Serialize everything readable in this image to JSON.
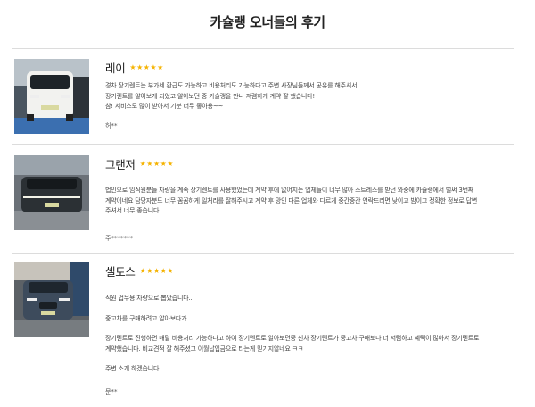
{
  "title": "카슐랭 오너들의 후기",
  "reviews": [
    {
      "car": "레이",
      "stars": "★★★★★",
      "lines": [
        "경차 장기렌트는 부가세 환급도 가능하고 비용처리도 가능하다고 주변 사장님들께서 공유를 해주셔서",
        "장기렌트를 알아보게 되었고 알아보던 중 카슐랭을 만나 저렴하게 계약 잘 했습니다!",
        "참! 서비스도 많이 받아서 기분 너무 좋아용~~"
      ],
      "author": "허**"
    },
    {
      "car": "그랜저",
      "stars": "★★★★★",
      "lines": [
        "법인으로 임직원분들 차량을 계속 장기렌트를 사용했었는데 계약 후에 없어지는 업체들이 너무 많아 스트레스를 받던 와중에 카슐랭에서 벌써 3번째",
        "계약이네요 담당자분도 너무 꼼꼼하게 일처리를 잘해주시고 계약 후 망인 다른 업체와 다르게 중간중간 연락드리면 낮이고 밤이고 정확한 정보로 답변",
        "주셔서 너무 좋습니다."
      ],
      "author": "주*******"
    },
    {
      "car": "셀토스",
      "stars": "★★★★★",
      "paragraphs": [
        [
          "직원 업무용 차량으로 뽑았습니다.."
        ],
        [
          "중고차를 구매하려고 알아보다가"
        ],
        [
          "장기렌트로 진행하면 매달 비용처리 가능하다고 하여 장기렌트로 알아보던중 신차 장기렌트가 중고차 구매보다 더 저렴하고 혜택이 많아서 장기렌트로",
          "계약했습니다. 비교견적 잘 해주셨고 이월납입금으로 타는게 믿기지않네요 ㅋㅋ"
        ],
        [
          "주변 소개 하겠습니다!"
        ]
      ],
      "author": "문**"
    }
  ],
  "colors": {
    "star": "#f5b301",
    "divider": "#dcdcdc",
    "title": "#222222"
  }
}
